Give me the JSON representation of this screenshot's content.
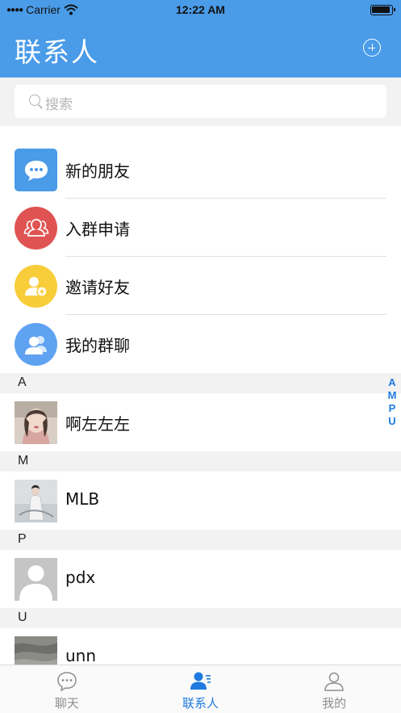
{
  "status_bar": {
    "carrier": "Carrier",
    "time": "12:22 AM"
  },
  "nav": {
    "title": "联系人",
    "add_icon": "plus-circle-icon"
  },
  "search": {
    "placeholder": "搜索"
  },
  "functions": [
    {
      "label": "新的朋友",
      "icon": "chat-bubble-icon",
      "color": "#4a9be8"
    },
    {
      "label": "入群申请",
      "icon": "group-icon",
      "color": "#e05353"
    },
    {
      "label": "邀请好友",
      "icon": "add-user-icon",
      "color": "#f8cd3a"
    },
    {
      "label": "我的群聊",
      "icon": "group-chat-icon",
      "color": "#5fa2f2"
    }
  ],
  "sections": [
    {
      "letter": "A",
      "contacts": [
        {
          "name": "啊左左左"
        }
      ]
    },
    {
      "letter": "M",
      "contacts": [
        {
          "name": "MLB"
        }
      ]
    },
    {
      "letter": "P",
      "contacts": [
        {
          "name": "pdx"
        }
      ]
    },
    {
      "letter": "U",
      "contacts": [
        {
          "name": "unn"
        }
      ]
    }
  ],
  "index_letters": [
    "A",
    "M",
    "P",
    "U"
  ],
  "tabs": [
    {
      "label": "聊天",
      "icon": "chat-icon",
      "active": false
    },
    {
      "label": "联系人",
      "icon": "contacts-icon",
      "active": true
    },
    {
      "label": "我的",
      "icon": "profile-icon",
      "active": false
    }
  ],
  "colors": {
    "accent": "#4a9be8",
    "tab_active": "#1f7ae0",
    "tab_inactive": "#8e8e8e"
  }
}
